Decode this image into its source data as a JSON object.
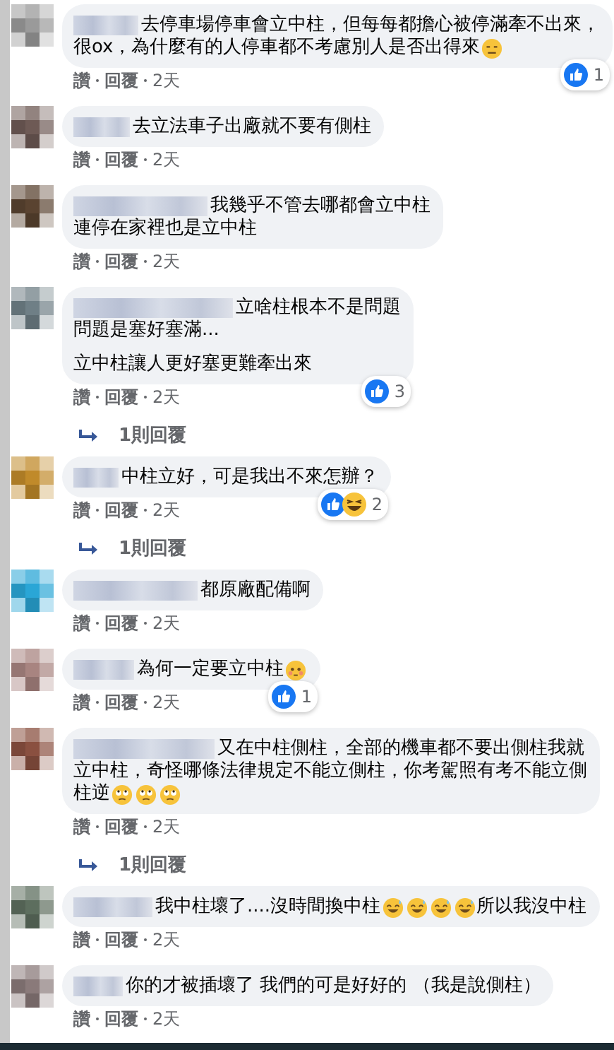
{
  "comments": [
    {
      "paragraphs": [
        [
          [
            {
              "kind": "text",
              "text": "去停車場停車會立中柱，但每每都擔心被停滿牽不出來，"
            }
          ],
          [
            {
              "kind": "text",
              "text": "很ox，為什麼有的人停車都不考慮別人是否出得來"
            },
            {
              "kind": "neutral"
            }
          ]
        ]
      ],
      "reactions": [
        {
          "kind": "like"
        }
      ],
      "reaction_count": "1",
      "actions": [
        "讚",
        "回覆"
      ],
      "time": "2天"
    },
    {
      "paragraphs": [
        [
          [
            {
              "kind": "text",
              "text": "去立法車子出廠就不要有側柱"
            }
          ]
        ]
      ],
      "actions": [
        "讚",
        "回覆"
      ],
      "time": "2天"
    },
    {
      "paragraphs": [
        [
          [
            {
              "kind": "text",
              "text": "我幾乎不管去哪都會立中柱"
            }
          ],
          [
            {
              "kind": "text",
              "text": "連停在家裡也是立中柱"
            }
          ]
        ]
      ],
      "actions": [
        "讚",
        "回覆"
      ],
      "time": "2天"
    },
    {
      "paragraphs": [
        [
          [
            {
              "kind": "text",
              "text": "立啥柱根本不是問題"
            }
          ],
          [
            {
              "kind": "text",
              "text": "問題是塞好塞滿..."
            }
          ]
        ],
        [
          [
            {
              "kind": "text",
              "text": "立中柱讓人更好塞更難牽出來"
            }
          ]
        ]
      ],
      "reactions": [
        {
          "kind": "like"
        }
      ],
      "reaction_count": "3",
      "actions": [
        "讚",
        "回覆"
      ],
      "time": "2天",
      "replies": "1則回覆"
    },
    {
      "paragraphs": [
        [
          [
            {
              "kind": "text",
              "text": "中柱立好，可是我出不來怎辦？"
            }
          ]
        ]
      ],
      "reactions": [
        {
          "kind": "like"
        },
        {
          "kind": "haha"
        }
      ],
      "reaction_count": "2",
      "actions": [
        "讚",
        "回覆"
      ],
      "time": "2天",
      "replies": "1則回覆"
    },
    {
      "paragraphs": [
        [
          [
            {
              "kind": "text",
              "text": "都原廠配備啊"
            }
          ]
        ]
      ],
      "actions": [
        "讚",
        "回覆"
      ],
      "time": "2天"
    },
    {
      "paragraphs": [
        [
          [
            {
              "kind": "text",
              "text": "為何一定要立中柱"
            },
            {
              "kind": "flushed"
            }
          ]
        ]
      ],
      "reactions": [
        {
          "kind": "like"
        }
      ],
      "reaction_count": "1",
      "actions": [
        "讚",
        "回覆"
      ],
      "time": "2天"
    },
    {
      "paragraphs": [
        [
          [
            {
              "kind": "text",
              "text": "又在中柱側柱，全部的機車都不要出側柱我就"
            }
          ],
          [
            {
              "kind": "text",
              "text": "立中柱，奇怪哪條法律規定不能立側柱，你考駕照有考不能立側"
            }
          ],
          [
            {
              "kind": "text",
              "text": "柱逆"
            },
            {
              "kind": "eyeroll"
            },
            {
              "kind": "eyeroll"
            },
            {
              "kind": "eyeroll"
            }
          ]
        ]
      ],
      "actions": [
        "讚",
        "回覆"
      ],
      "time": "2天",
      "replies": "1則回覆"
    },
    {
      "paragraphs": [
        [
          [
            {
              "kind": "text",
              "text": "我中柱壞了....沒時間換中柱"
            },
            {
              "kind": "sweat"
            },
            {
              "kind": "sweat"
            },
            {
              "kind": "sweat"
            },
            {
              "kind": "sweat"
            },
            {
              "kind": "text",
              "text": "所以我沒中柱"
            }
          ]
        ]
      ],
      "actions": [
        "讚",
        "回覆"
      ],
      "time": "2天"
    },
    {
      "paragraphs": [
        [
          [
            {
              "kind": "text",
              "text": "你的才被插壞了 我們的可是好好的 （我是說側柱）"
            }
          ]
        ]
      ],
      "actions": [
        "讚",
        "回覆"
      ],
      "time": "2天"
    }
  ]
}
